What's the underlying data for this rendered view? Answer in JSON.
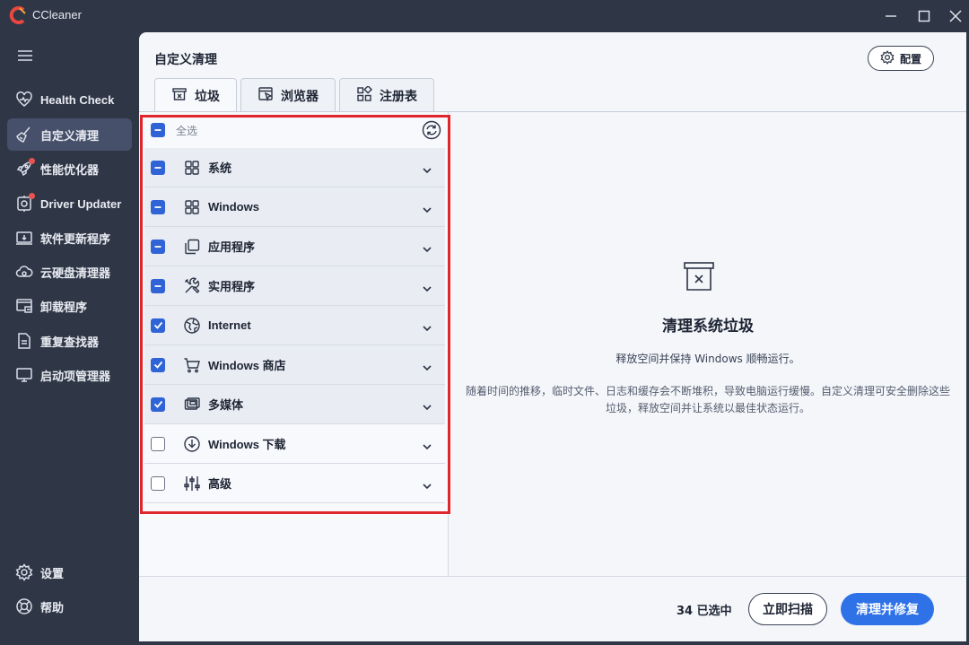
{
  "window": {
    "title": "CCleaner",
    "controls": [
      "minimize-icon",
      "maximize-icon",
      "close-icon"
    ]
  },
  "sidebar": {
    "items": [
      {
        "label": "Health Check",
        "icon": "heart-icon",
        "active": false,
        "dot": false
      },
      {
        "label": "自定义清理",
        "icon": "broom-icon",
        "active": true,
        "dot": false
      },
      {
        "label": "性能优化器",
        "icon": "rocket-icon",
        "active": false,
        "dot": true
      },
      {
        "label": "Driver Updater",
        "icon": "gear-chip-icon",
        "active": false,
        "dot": true
      },
      {
        "label": "软件更新程序",
        "icon": "update-icon",
        "active": false,
        "dot": false
      },
      {
        "label": "云硬盘清理器",
        "icon": "cloud-icon",
        "active": false,
        "dot": false
      },
      {
        "label": "卸载程序",
        "icon": "uninstall-icon",
        "active": false,
        "dot": false
      },
      {
        "label": "重复查找器",
        "icon": "duplicate-icon",
        "active": false,
        "dot": false
      },
      {
        "label": "启动项管理器",
        "icon": "monitor-icon",
        "active": false,
        "dot": false
      }
    ],
    "bottom": [
      {
        "label": "设置",
        "icon": "settings-icon"
      },
      {
        "label": "帮助",
        "icon": "help-icon"
      }
    ]
  },
  "main": {
    "title": "自定义清理",
    "config_label": "配置",
    "tabs": [
      {
        "label": "垃圾",
        "icon": "trash-icon",
        "active": true
      },
      {
        "label": "浏览器",
        "icon": "browser-icon",
        "active": false
      },
      {
        "label": "注册表",
        "icon": "registry-icon",
        "active": false
      }
    ],
    "select_all": {
      "label": "全选",
      "state": "partial"
    },
    "categories": [
      {
        "label": "系统",
        "icon": "windows-icon",
        "state": "partial"
      },
      {
        "label": "Windows",
        "icon": "windows-icon",
        "state": "partial"
      },
      {
        "label": "应用程序",
        "icon": "apps-icon",
        "state": "partial"
      },
      {
        "label": "实用程序",
        "icon": "tools-icon",
        "state": "partial"
      },
      {
        "label": "Internet",
        "icon": "globe-icon",
        "state": "checked"
      },
      {
        "label": "Windows 商店",
        "icon": "cart-icon",
        "state": "checked"
      },
      {
        "label": "多媒体",
        "icon": "media-icon",
        "state": "checked"
      },
      {
        "label": "Windows 下载",
        "icon": "download-icon",
        "state": "empty"
      },
      {
        "label": "高级",
        "icon": "sliders-icon",
        "state": "empty"
      }
    ],
    "info": {
      "title": "清理系统垃圾",
      "subtitle": "释放空间并保持 Windows 顺畅运行。",
      "description": "随着时间的推移，临时文件、日志和缓存会不断堆积，导致电脑运行缓慢。自定义清理可安全删除这些垃圾，释放空间并让系统以最佳状态运行。"
    },
    "footer": {
      "selected_count": "34 已选中",
      "scan_label": "立即扫描",
      "clean_label": "清理并修复"
    }
  },
  "colors": {
    "sidebar_bg": "#2f3747",
    "accent": "#2f72e8",
    "checkbox": "#2f63d6",
    "highlight": "#e0262d"
  }
}
